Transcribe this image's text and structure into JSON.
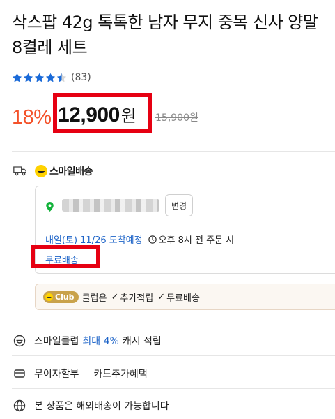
{
  "product": {
    "title_line1": "삭스팝 42g 톡톡한 남자 무지 중목 신사 양말",
    "title_line2": "8켤레 세트"
  },
  "rating": {
    "stars": 4.5,
    "review_count": "(83)"
  },
  "price": {
    "discount": "18%",
    "sale_price": "12,900",
    "currency": "원",
    "original_price": "15,900원"
  },
  "shipping": {
    "badge_label": "스마일배송",
    "address_masked": "",
    "change_button": "변경",
    "eta": "내일(토) 11/26 도착예정",
    "cutoff": "오후 8시 전 주문 시",
    "free_shipping": "무료배송"
  },
  "club": {
    "badge": "Club",
    "text": "클럽은",
    "benefit1": "추가적립",
    "benefit2": "무료배송"
  },
  "benefits": {
    "cash_prefix": "스마일클럽",
    "cash_highlight": "최대 4%",
    "cash_suffix": "캐시 적립",
    "installment": "무이자할부",
    "card": "카드추가혜택",
    "overseas": "본 상품은 해외배송이 가능합니다"
  },
  "colors": {
    "accent_orange": "#f4522a",
    "link_blue": "#1e64c8",
    "highlight_red": "#e60012",
    "star_blue": "#1a6ad8"
  }
}
